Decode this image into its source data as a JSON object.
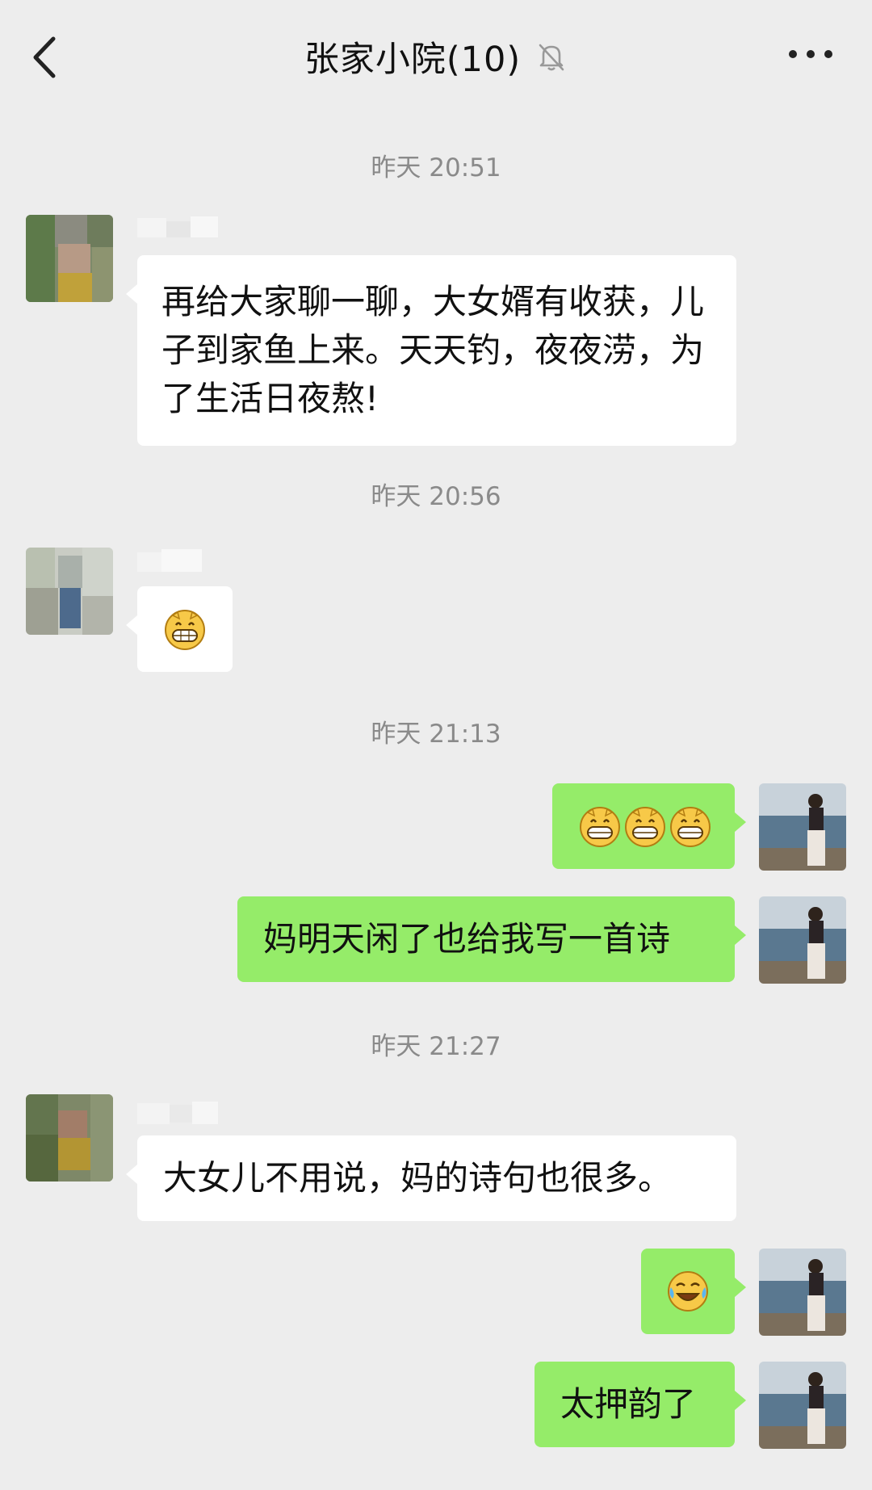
{
  "header": {
    "title": "张家小院(10)",
    "back_icon": "chevron-left-icon",
    "mute_icon": "bell-off-icon",
    "more_icon": "more-dots-icon"
  },
  "timestamps": [
    "昨天 20:51",
    "昨天 20:56",
    "昨天 21:13",
    "昨天 21:27"
  ],
  "messages": [
    {
      "side": "left",
      "text": "再给大家聊一聊，大女婿有收获，儿子到家鱼上来。天天钓，夜夜涝，为了生活日夜熬!"
    },
    {
      "side": "left",
      "emoji": "grin-emoji",
      "count": 1
    },
    {
      "side": "right",
      "emoji": "grin-emoji",
      "count": 3
    },
    {
      "side": "right",
      "text": "妈明天闲了也给我写一首诗"
    },
    {
      "side": "left",
      "text": "大女儿不用说，妈的诗句也很多。"
    },
    {
      "side": "right",
      "emoji": "laugh-cry-emoji",
      "count": 1
    },
    {
      "side": "right",
      "text": "太押韵了"
    }
  ],
  "colors": {
    "background": "#ededed",
    "right_bubble": "#95ec69",
    "left_bubble": "#ffffff",
    "timestamp": "#8a8a8a"
  }
}
